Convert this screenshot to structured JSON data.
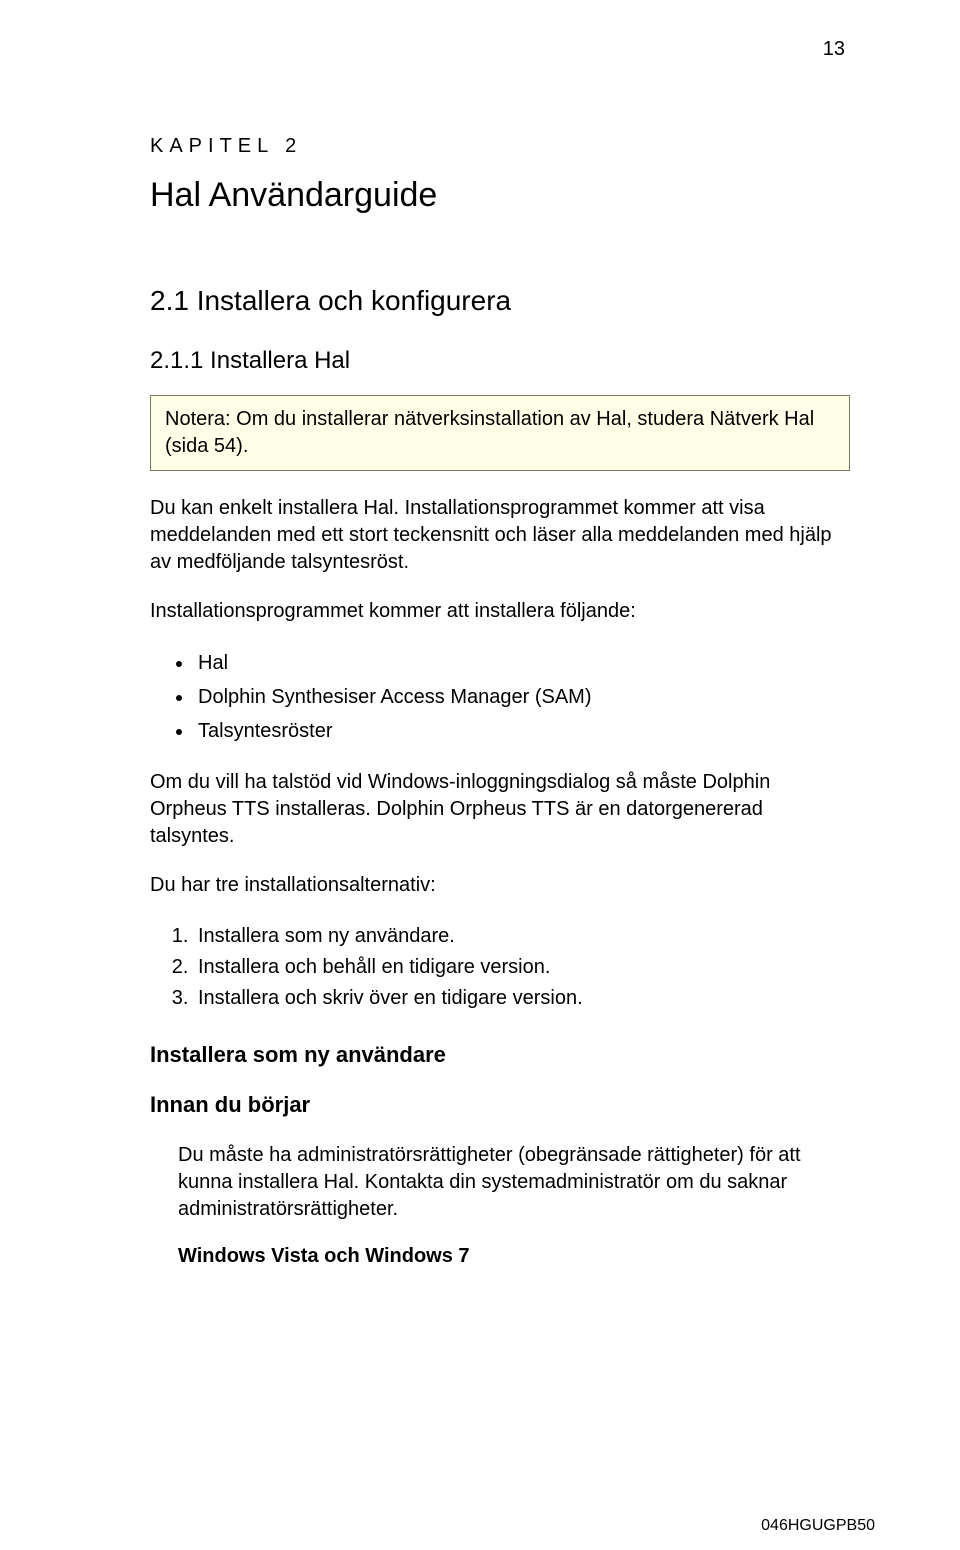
{
  "page_number": "13",
  "chapter": {
    "label": "KAPITEL 2",
    "title": "Hal Användarguide"
  },
  "section_h2": "2.1  Installera och konfigurera",
  "section_h3": "2.1.1  Installera Hal",
  "note": {
    "prefix": "Notera:",
    "text": " Om du installerar nätverksinstallation av Hal, studera Nätverk Hal (sida   54)."
  },
  "p1": "Du kan enkelt installera Hal. Installationsprogrammet kommer att visa meddelanden med ett stort teckensnitt och läser alla meddelanden med hjälp av medföljande talsyntesröst.",
  "p2": "Installationsprogrammet kommer att installera följande:",
  "bullets": [
    "Hal",
    "Dolphin Synthesiser Access Manager (SAM)",
    "Talsyntesröster"
  ],
  "p3": "Om du vill ha talstöd vid Windows-inloggningsdialog så måste Dolphin Orpheus TTS installeras. Dolphin Orpheus TTS är en datorgenererad talsyntes.",
  "p4": "Du har tre installationsalternativ:",
  "numbers": [
    "Installera som ny användare.",
    "Installera och behåll en tidigare version.",
    "Installera och skriv över en tidigare version."
  ],
  "h_install_new": "Installera som ny användare",
  "h_before": "Innan du börjar",
  "p5": "Du måste ha administratörsrättigheter (obegränsade rättigheter) för att kunna installera Hal. Kontakta din systemadministratör om du saknar administratörsrättigheter.",
  "h_win": "Windows Vista och Windows 7",
  "footer_code": "046HGUGPB50"
}
